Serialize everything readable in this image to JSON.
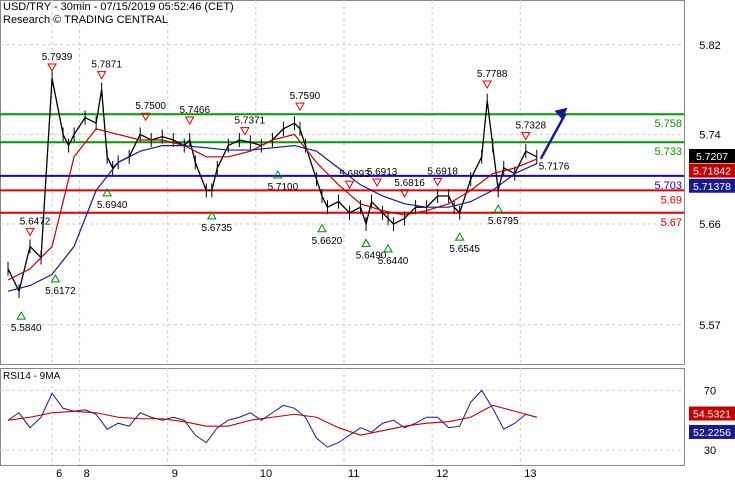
{
  "header": {
    "title": "USD/TRY - 30min - 07/15/2019 05:52:46 (CET)",
    "source": "Research © TRADING CENTRAL"
  },
  "colors": {
    "background": "#ffffff",
    "grid": "#cccccc",
    "price": "#000000",
    "ma_fast": "#c00000",
    "ma_slow": "#1a1a8c",
    "resistance": "#009900",
    "pivot": "#2200bb",
    "support": "#dd0000",
    "arrow": "#1a1a8c",
    "rsi": "#1a1a8c",
    "rsi_ma": "#c00000"
  },
  "chart_data": [
    {
      "type": "line",
      "title": "USD/TRY - 30min",
      "ylim": [
        5.535,
        5.86
      ],
      "y_ticks": [
        "5.82",
        "5.74",
        "5.66",
        "5.57"
      ],
      "x_ticks": [
        "6",
        "8",
        "9",
        "10",
        "11",
        "12",
        "13"
      ],
      "grid": true,
      "current_price": "5.7207",
      "levels": [
        {
          "label": "5.758",
          "value": 5.758,
          "role": "resistance"
        },
        {
          "label": "5.733",
          "value": 5.733,
          "role": "resistance"
        },
        {
          "label": "5.703",
          "value": 5.703,
          "role": "pivot"
        },
        {
          "label": "5.69",
          "value": 5.69,
          "role": "support"
        },
        {
          "label": "5.67",
          "value": 5.67,
          "role": "support"
        }
      ],
      "ma_values": [
        "5.71842",
        "5.71378"
      ],
      "annotations": [
        {
          "label": "5.7939",
          "x": 4,
          "y": 5.7939,
          "kind": "high"
        },
        {
          "label": "5.7871",
          "x": 8.5,
          "y": 5.7871,
          "kind": "high"
        },
        {
          "label": "5.6472",
          "x": 2,
          "y": 5.6472,
          "kind": "high"
        },
        {
          "label": "5.7500",
          "x": 12.5,
          "y": 5.75,
          "kind": "high"
        },
        {
          "label": "5.7466",
          "x": 16.5,
          "y": 5.7466,
          "kind": "high"
        },
        {
          "label": "5.7371",
          "x": 21.5,
          "y": 5.7371,
          "kind": "high"
        },
        {
          "label": "5.7590",
          "x": 26.5,
          "y": 5.759,
          "kind": "high"
        },
        {
          "label": "5.6893",
          "x": 31,
          "y": 5.6893,
          "kind": "high"
        },
        {
          "label": "5.6913",
          "x": 33.5,
          "y": 5.6913,
          "kind": "high"
        },
        {
          "label": "5.6816",
          "x": 36,
          "y": 5.6816,
          "kind": "high"
        },
        {
          "label": "5.6918",
          "x": 39,
          "y": 5.6918,
          "kind": "high"
        },
        {
          "label": "5.7788",
          "x": 43.5,
          "y": 5.7788,
          "kind": "high"
        },
        {
          "label": "5.7328",
          "x": 47,
          "y": 5.7328,
          "kind": "high"
        },
        {
          "label": "5.5840",
          "x": 1.2,
          "y": 5.584,
          "kind": "low"
        },
        {
          "label": "5.6172",
          "x": 4.3,
          "y": 5.6172,
          "kind": "low"
        },
        {
          "label": "5.6940",
          "x": 9,
          "y": 5.694,
          "kind": "low"
        },
        {
          "label": "5.6735",
          "x": 18.5,
          "y": 5.6735,
          "kind": "low"
        },
        {
          "label": "5.7100",
          "x": 24.5,
          "y": 5.71,
          "kind": "low"
        },
        {
          "label": "5.6620",
          "x": 28.5,
          "y": 5.662,
          "kind": "low"
        },
        {
          "label": "5.6490",
          "x": 32.5,
          "y": 5.649,
          "kind": "low"
        },
        {
          "label": "5.6440",
          "x": 34.5,
          "y": 5.644,
          "kind": "low"
        },
        {
          "label": "5.6545",
          "x": 41,
          "y": 5.6545,
          "kind": "low"
        },
        {
          "label": "5.6795",
          "x": 44.5,
          "y": 5.6795,
          "kind": "low"
        },
        {
          "label": "5.7176",
          "x": 48,
          "y": 5.7176,
          "kind": "note"
        }
      ],
      "x_extent": [
        0,
        61
      ],
      "series": [
        {
          "x": [
            0,
            1,
            2,
            3,
            4,
            5,
            5.5,
            6,
            7,
            8,
            8.5,
            9,
            9.5,
            10,
            11,
            12,
            13,
            14,
            15,
            16,
            16.5,
            17,
            18,
            18.5,
            19,
            20,
            21,
            22,
            23,
            24,
            25,
            26,
            26.5,
            27,
            28,
            28.5,
            29,
            30,
            31,
            32,
            32.5,
            33,
            34,
            34.5,
            35,
            36,
            37,
            38,
            39,
            40,
            40.5,
            41,
            42,
            43,
            43.5,
            44,
            44.5,
            45,
            46,
            47,
            48
          ],
          "y": [
            5.62,
            5.6,
            5.64,
            5.63,
            5.79,
            5.74,
            5.73,
            5.74,
            5.755,
            5.75,
            5.78,
            5.72,
            5.71,
            5.715,
            5.72,
            5.74,
            5.735,
            5.738,
            5.735,
            5.73,
            5.735,
            5.715,
            5.69,
            5.69,
            5.71,
            5.73,
            5.735,
            5.733,
            5.73,
            5.735,
            5.745,
            5.75,
            5.745,
            5.73,
            5.7,
            5.685,
            5.675,
            5.68,
            5.67,
            5.675,
            5.66,
            5.68,
            5.67,
            5.665,
            5.66,
            5.665,
            5.675,
            5.675,
            5.685,
            5.685,
            5.675,
            5.67,
            5.7,
            5.72,
            5.77,
            5.73,
            5.69,
            5.71,
            5.705,
            5.725,
            5.72
          ]
        },
        {
          "x": [
            0,
            2,
            4,
            6,
            8,
            10,
            12,
            14,
            16,
            18,
            20,
            22,
            24,
            26,
            28,
            30,
            32,
            34,
            36,
            38,
            40,
            42,
            44,
            46,
            48
          ],
          "y": [
            5.61,
            5.62,
            5.64,
            5.72,
            5.745,
            5.74,
            5.735,
            5.735,
            5.73,
            5.72,
            5.72,
            5.725,
            5.735,
            5.74,
            5.715,
            5.695,
            5.678,
            5.672,
            5.668,
            5.672,
            5.678,
            5.69,
            5.705,
            5.71,
            5.718
          ]
        },
        {
          "x": [
            0,
            2,
            4,
            6,
            8,
            10,
            12,
            14,
            16,
            18,
            20,
            22,
            24,
            26,
            28,
            30,
            32,
            34,
            36,
            38,
            40,
            42,
            44,
            46,
            48
          ],
          "y": [
            5.6,
            5.605,
            5.615,
            5.64,
            5.69,
            5.715,
            5.725,
            5.73,
            5.73,
            5.728,
            5.726,
            5.726,
            5.728,
            5.73,
            5.725,
            5.71,
            5.695,
            5.685,
            5.678,
            5.675,
            5.675,
            5.68,
            5.69,
            5.705,
            5.714
          ]
        }
      ]
    },
    {
      "type": "line",
      "title": "RSI14 - 9MA",
      "ylim": [
        20,
        85
      ],
      "y_ticks": [
        "70",
        "30"
      ],
      "grid": true,
      "rsi_value": "54.5321",
      "ma_value": "52.2256",
      "series": [
        {
          "x": [
            0,
            1,
            2,
            3,
            4,
            5,
            6,
            7,
            8,
            9,
            10,
            11,
            12,
            13,
            14,
            15,
            16,
            17,
            18,
            19,
            20,
            21,
            22,
            23,
            24,
            25,
            26,
            27,
            28,
            29,
            30,
            31,
            32,
            33,
            34,
            35,
            36,
            37,
            38,
            39,
            40,
            41,
            42,
            43,
            44,
            45,
            46,
            47,
            48
          ],
          "y": [
            50,
            55,
            45,
            52,
            68,
            58,
            56,
            57,
            54,
            44,
            48,
            46,
            55,
            52,
            50,
            52,
            50,
            40,
            35,
            45,
            50,
            52,
            55,
            50,
            55,
            60,
            58,
            52,
            38,
            32,
            35,
            40,
            45,
            42,
            48,
            50,
            45,
            48,
            52,
            52,
            45,
            46,
            62,
            70,
            58,
            44,
            48,
            54,
            52
          ]
        },
        {
          "x": [
            0,
            2,
            4,
            6,
            8,
            10,
            12,
            14,
            16,
            18,
            20,
            22,
            24,
            26,
            28,
            30,
            32,
            34,
            36,
            38,
            40,
            42,
            44,
            46,
            48
          ],
          "y": [
            50,
            52,
            55,
            56,
            55,
            52,
            51,
            51,
            49,
            46,
            46,
            50,
            52,
            54,
            52,
            45,
            40,
            43,
            46,
            48,
            49,
            52,
            60,
            56,
            52
          ]
        }
      ]
    }
  ]
}
